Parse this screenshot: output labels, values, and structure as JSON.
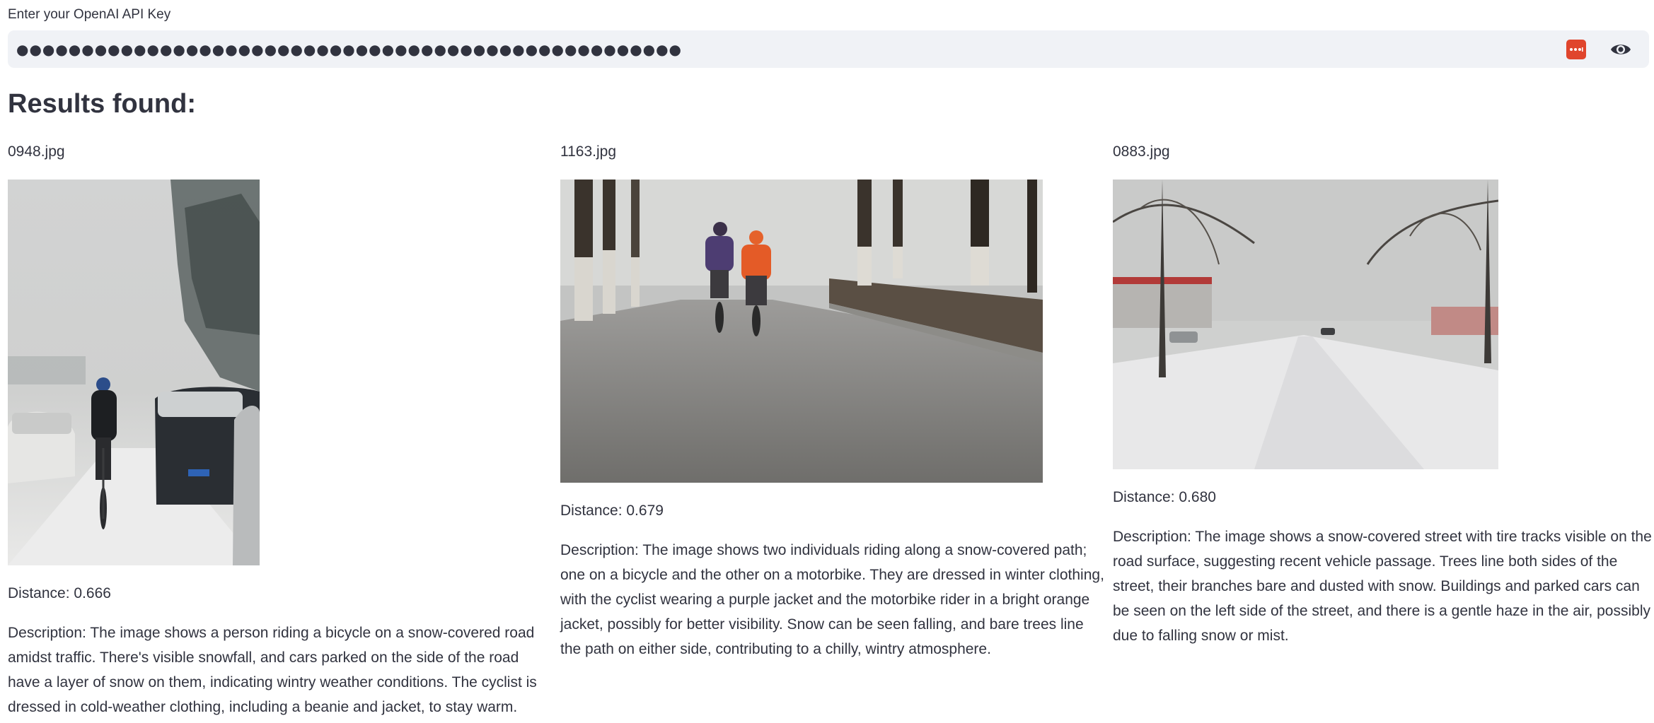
{
  "api_key": {
    "label": "Enter your OpenAI API Key",
    "masked_value": "●●●●●●●●●●●●●●●●●●●●●●●●●●●●●●●●●●●●●●●●●●●●●●●●●●●"
  },
  "results": {
    "heading": "Results found:",
    "items": [
      {
        "filename": "0948.jpg",
        "distance": "Distance: 0.666",
        "description": "Description: The image shows a person riding a bicycle on a snow-covered road amidst traffic. There's visible snowfall, and cars parked on the side of the road have a layer of snow on them, indicating wintry weather conditions. The cyclist is dressed in cold-weather clothing, including a beanie and jacket, to stay warm."
      },
      {
        "filename": "1163.jpg",
        "distance": "Distance: 0.679",
        "description": "Description: The image shows two individuals riding along a snow-covered path; one on a bicycle and the other on a motorbike. They are dressed in winter clothing, with the cyclist wearing a purple jacket and the motorbike rider in a bright orange jacket, possibly for better visibility. Snow can be seen falling, and bare trees line the path on either side, contributing to a chilly, wintry atmosphere."
      },
      {
        "filename": "0883.jpg",
        "distance": "Distance: 0.680",
        "description": "Description: The image shows a snow-covered street with tire tracks visible on the road surface, suggesting recent vehicle passage. Trees line both sides of the street, their branches bare and dusted with snow. Buildings and parked cars can be seen on the left side of the street, and there is a gentle haze in the air, possibly due to falling snow or mist."
      }
    ]
  },
  "icons": {
    "password_manager": "password-manager-icon",
    "visibility": "eye-icon"
  },
  "colors": {
    "input_background": "#f0f2f6",
    "text": "#31333f",
    "password_manager_accent": "#e0452c"
  }
}
